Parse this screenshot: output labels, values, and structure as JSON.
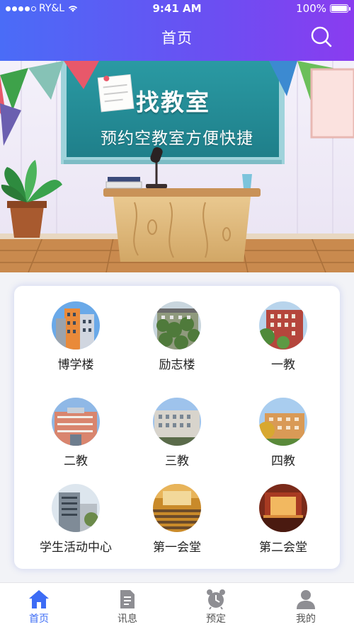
{
  "status_bar": {
    "carrier": "RY&L",
    "time": "9:41 AM",
    "battery": "100%"
  },
  "nav": {
    "title": "首页",
    "search_icon": "search-icon"
  },
  "banner": {
    "title": "找教室",
    "subtitle": "预约空教室方便快捷"
  },
  "buildings": [
    {
      "label": "博学楼",
      "icon": "building-photo"
    },
    {
      "label": "励志楼",
      "icon": "building-photo"
    },
    {
      "label": "一教",
      "icon": "building-photo"
    },
    {
      "label": "二教",
      "icon": "building-photo"
    },
    {
      "label": "三教",
      "icon": "building-photo"
    },
    {
      "label": "四教",
      "icon": "building-photo"
    },
    {
      "label": "学生活动中心",
      "icon": "building-photo"
    },
    {
      "label": "第一会堂",
      "icon": "auditorium-photo"
    },
    {
      "label": "第二会堂",
      "icon": "auditorium-photo"
    }
  ],
  "tabbar": {
    "items": [
      {
        "label": "首页",
        "icon": "home-icon",
        "active": true
      },
      {
        "label": "讯息",
        "icon": "document-icon",
        "active": false
      },
      {
        "label": "预定",
        "icon": "alarm-clock-icon",
        "active": false
      },
      {
        "label": "我的",
        "icon": "user-icon",
        "active": false
      }
    ]
  },
  "colors": {
    "header_start": "#4a6cf7",
    "header_end": "#8a3cf0",
    "active_tab": "#3d6cf5",
    "inactive_tab": "#8e8e93"
  }
}
